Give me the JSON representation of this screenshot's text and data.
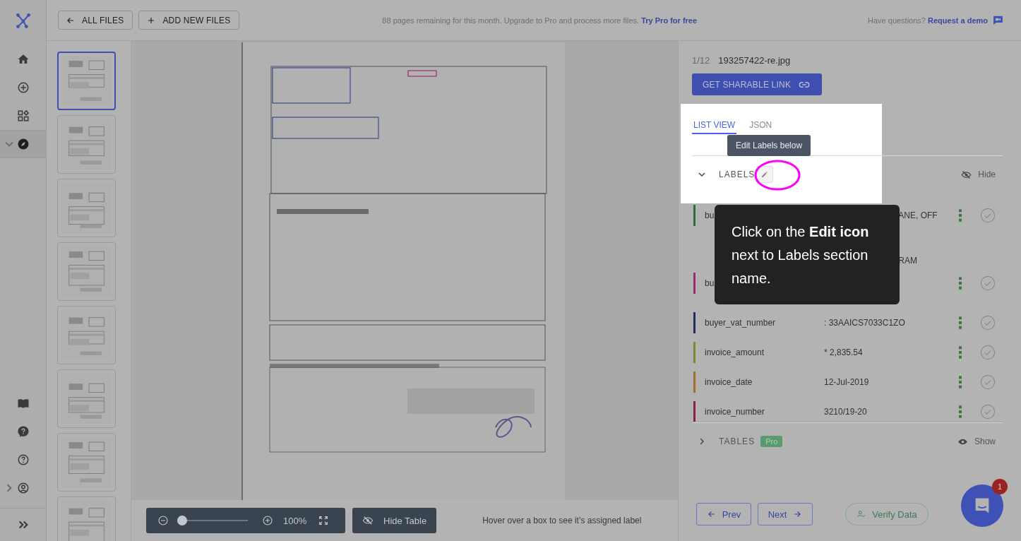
{
  "rail": {
    "items": [
      {
        "kind": "home",
        "selected": false
      },
      {
        "kind": "add",
        "selected": false
      },
      {
        "kind": "widgets",
        "selected": false
      },
      {
        "kind": "compass",
        "selected": true,
        "expanded": true
      }
    ],
    "bottom_items": [
      {
        "kind": "book",
        "selected": false
      },
      {
        "kind": "help",
        "selected": false
      },
      {
        "kind": "question",
        "selected": false
      },
      {
        "kind": "account",
        "selected": false,
        "expanded": false
      }
    ]
  },
  "top_bar": {
    "buttons": [
      {
        "label": "ALL FILES",
        "kind": "back"
      },
      {
        "label": "ADD NEW FILES",
        "kind": "add"
      }
    ],
    "notice": {
      "text": "88 pages remaining for this month. Upgrade to Pro and process more files.",
      "link": "Try Pro for free"
    },
    "help": {
      "text": "Have questions?",
      "link": "Request a demo"
    }
  },
  "pages": [
    {
      "selected": true
    },
    {
      "selected": false
    },
    {
      "selected": false
    },
    {
      "selected": false
    },
    {
      "selected": false
    },
    {
      "selected": false
    },
    {
      "selected": false
    },
    {
      "selected": false
    }
  ],
  "viewer": {
    "zoom": {
      "level": 0,
      "reading": "100%"
    },
    "table_toggle": "Hide Table",
    "hint": "Hover over a box to see it’s assigned label"
  },
  "panel": {
    "counter": "1/12",
    "file_name": "193257422-re.jpg",
    "share_button": "GET SHARABLE LINK",
    "tabs": [
      {
        "label": "LIST VIEW",
        "selected": true
      },
      {
        "label": "JSON",
        "selected": false
      }
    ],
    "sections": [
      {
        "title": "LABELS",
        "expanded": true,
        "toggle": "Hide"
      },
      {
        "title": "TABLES",
        "expanded": false,
        "badge": "Pro",
        "toggle": "Show"
      }
    ],
    "labels": [
      {
        "kind": "partial",
        "label": "bu",
        "value_lines": [
          "ANE, OFF",
          "RAM"
        ],
        "color": "#2f6b35"
      },
      {
        "kind": "partial",
        "label": "bu",
        "color": "#9b2c6a"
      },
      {
        "kind": "full",
        "label": "buyer_vat_number",
        "value": ": 33AAICS7033C1ZO",
        "color": "#1f2f5a"
      },
      {
        "kind": "full",
        "label": "invoice_amount",
        "value": "* 2,835.54",
        "color": "#7a8a30"
      },
      {
        "kind": "full",
        "label": "invoice_date",
        "value": "12-Jul-2019",
        "color": "#a07028"
      },
      {
        "kind": "full",
        "label": "invoice_number",
        "value": "3210/19-20",
        "color": "#8e1f48"
      }
    ],
    "nav": {
      "prev": "Prev",
      "next": "Next",
      "verify": "Verify Data"
    },
    "chat_badge": "1"
  },
  "tour": {
    "hint": "Edit Labels below",
    "message": "Click on the **Edit icon** next to Labels section name."
  }
}
